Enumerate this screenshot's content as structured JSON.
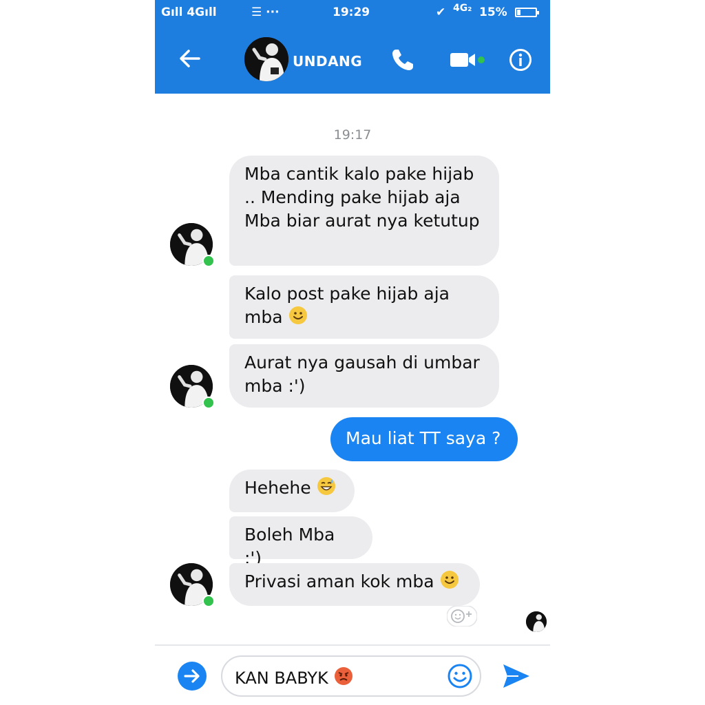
{
  "status_bar": {
    "signal_left": "Gıll 4Gıll",
    "extra_icons": "☰ ···",
    "time": "19:29",
    "network": "4G₂",
    "battery": "15%"
  },
  "header": {
    "contact_name": "UNDANG",
    "icons": [
      "back-arrow-icon",
      "phone-icon",
      "video-camera-icon",
      "info-icon"
    ]
  },
  "chat": {
    "timestamp": "19:17",
    "messages": [
      {
        "side": "in",
        "text": "Mba cantik kalo pake hijab .. Mending pake hijab aja Mba biar aurat nya ketutup"
      },
      {
        "side": "in",
        "text": "Kalo post pake hijab aja mba",
        "emoji": "slightly-smiling-face"
      },
      {
        "side": "in",
        "text": "Aurat nya gausah di umbar mba :')"
      },
      {
        "side": "out",
        "text": "Mau liat TT saya ?"
      },
      {
        "side": "in",
        "text": "Hehehe",
        "emoji": "grinning-sweat-face"
      },
      {
        "side": "in",
        "text": "Boleh Mba :')"
      },
      {
        "side": "in",
        "text": "Privasi aman kok mba",
        "emoji": "slightly-smiling-face"
      }
    ]
  },
  "composer": {
    "text": "KAN BABYK",
    "emoji": "angry-face",
    "icons": [
      "expand-arrow-icon",
      "emoji-icon",
      "send-icon"
    ]
  },
  "colors": {
    "brand": "#1e7ee0",
    "outgoing_bubble": "#1a84f2",
    "incoming_bubble": "#ececee",
    "online": "#32c24d"
  }
}
